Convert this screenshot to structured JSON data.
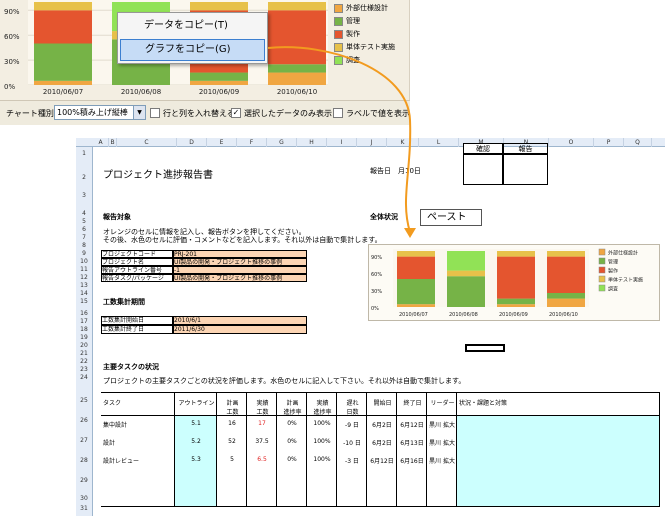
{
  "top_chart": {
    "y_ticks": [
      "90%",
      "60%",
      "30%",
      "0%"
    ],
    "x_ticks": [
      "2010/06/07",
      "2010/06/08",
      "2010/06/09",
      "2010/06/10"
    ]
  },
  "legend": [
    {
      "label": "外部仕様設計",
      "color": "#f0a642"
    },
    {
      "label": "管理",
      "color": "#76b347"
    },
    {
      "label": "製作",
      "color": "#e4552f"
    },
    {
      "label": "単体テスト実施",
      "color": "#e7c14a"
    },
    {
      "label": "調査",
      "color": "#91e256"
    }
  ],
  "chart_data": {
    "type": "bar",
    "stacked": "100%",
    "categories": [
      "2010/06/07",
      "2010/06/08",
      "2010/06/09",
      "2010/06/10"
    ],
    "series": [
      {
        "name": "外部仕様設計",
        "values": [
          5,
          0,
          5,
          15
        ]
      },
      {
        "name": "管理",
        "values": [
          45,
          55,
          10,
          10
        ]
      },
      {
        "name": "製作",
        "values": [
          40,
          0,
          75,
          65
        ]
      },
      {
        "name": "単体テスト実施",
        "values": [
          10,
          10,
          10,
          10
        ]
      },
      {
        "name": "調査",
        "values": [
          0,
          35,
          0,
          0
        ]
      }
    ],
    "ylim": [
      0,
      100
    ],
    "y_ticks": [
      "0%",
      "30%",
      "60%",
      "90%"
    ]
  },
  "context_menu": {
    "copy_data": "データをコピー(T)",
    "copy_graph": "グラフをコピー(G)"
  },
  "toolbar": {
    "chart_type_label": "チャート種別",
    "chart_type_value": "100%積み上げ縦棒",
    "swap_label": "行と列を入れ替える",
    "selected_only_label": "選択したデータのみ表示",
    "show_labels_label": "ラベルで値を表示"
  },
  "paste_label": "ペースト",
  "sheet": {
    "columns": [
      "A",
      "B",
      "C",
      "D",
      "E",
      "F",
      "G",
      "H",
      "I",
      "J",
      "K",
      "L",
      "M",
      "N",
      "O",
      "P",
      "Q"
    ],
    "title": "プロジェクト進捗報告書",
    "report_date_label": "報告日",
    "report_date_value": "月10日",
    "confirm_label": "確認",
    "report_label": "報告",
    "section_target": "報告対象",
    "instructions_1": "オレンジのセルに情報を記入し、報告ボタンを押してください。",
    "instructions_2": "その後、水色のセルに評価・コメントなどを記入します。それ以外は自動で集計します。",
    "fields": [
      {
        "label": "プロジェクトコード",
        "value": "PRJ-201"
      },
      {
        "label": "プロジェクト名",
        "value": "UI製品の開発・プロジェクト推移の事例"
      },
      {
        "label": "報告アウトライン番号",
        "value": "-1"
      },
      {
        "label": "報告タスク/パッケージ",
        "value": "UI製品の開発・プロジェクト推移の事例"
      }
    ],
    "section_period": "工数集計期間",
    "period": [
      {
        "label": "工数集計開始日",
        "value": "2010/6/1"
      },
      {
        "label": "工数集計終了日",
        "value": "2011/6/30"
      }
    ],
    "section_overall": "全体状況",
    "section_tasks": "主要タスクの状況",
    "tasks_instructions": "プロジェクトの主要タスクごとの状況を評価します。水色のセルに記入して下さい。それ以外は自動で集計します。",
    "task_headers": [
      "タスク",
      "アウトライン",
      "計画\n工数",
      "実績\n工数",
      "計画\n進捗率",
      "実績\n進捗率",
      "遅れ\n日数",
      "開始日",
      "終了日",
      "リーダー",
      "状況・課題と対策"
    ],
    "tasks": [
      {
        "name": "集中設計",
        "outline": "5.1",
        "plan": "16",
        "actual": "17",
        "plan_rate": "0%",
        "actual_rate": "100%",
        "delay": "-9 日",
        "start": "6月2日",
        "end": "6月12日",
        "leader": "黒川 拡大"
      },
      {
        "name": "設計",
        "outline": "5.2",
        "plan": "52",
        "actual": "37.5",
        "plan_rate": "0%",
        "actual_rate": "100%",
        "delay": "-10 日",
        "start": "6月2日",
        "end": "6月13日",
        "leader": "黒川 拡大"
      },
      {
        "name": "設計レビュー",
        "outline": "5.3",
        "plan": "5",
        "actual": "6.5",
        "plan_rate": "0%",
        "actual_rate": "100%",
        "delay": "-3 日",
        "start": "6月12日",
        "end": "6月16日",
        "leader": "黒川 拡大"
      }
    ],
    "rows": [
      "1",
      "2",
      "3",
      "4",
      "5",
      "6",
      "7",
      "8",
      "9",
      "10",
      "11",
      "12",
      "13",
      "14",
      "15",
      "16",
      "17",
      "18",
      "19",
      "20",
      "21",
      "22",
      "23",
      "24",
      "25",
      "26",
      "27",
      "28",
      "29",
      "30",
      "31"
    ],
    "accent_actual_over": "#e02020"
  }
}
